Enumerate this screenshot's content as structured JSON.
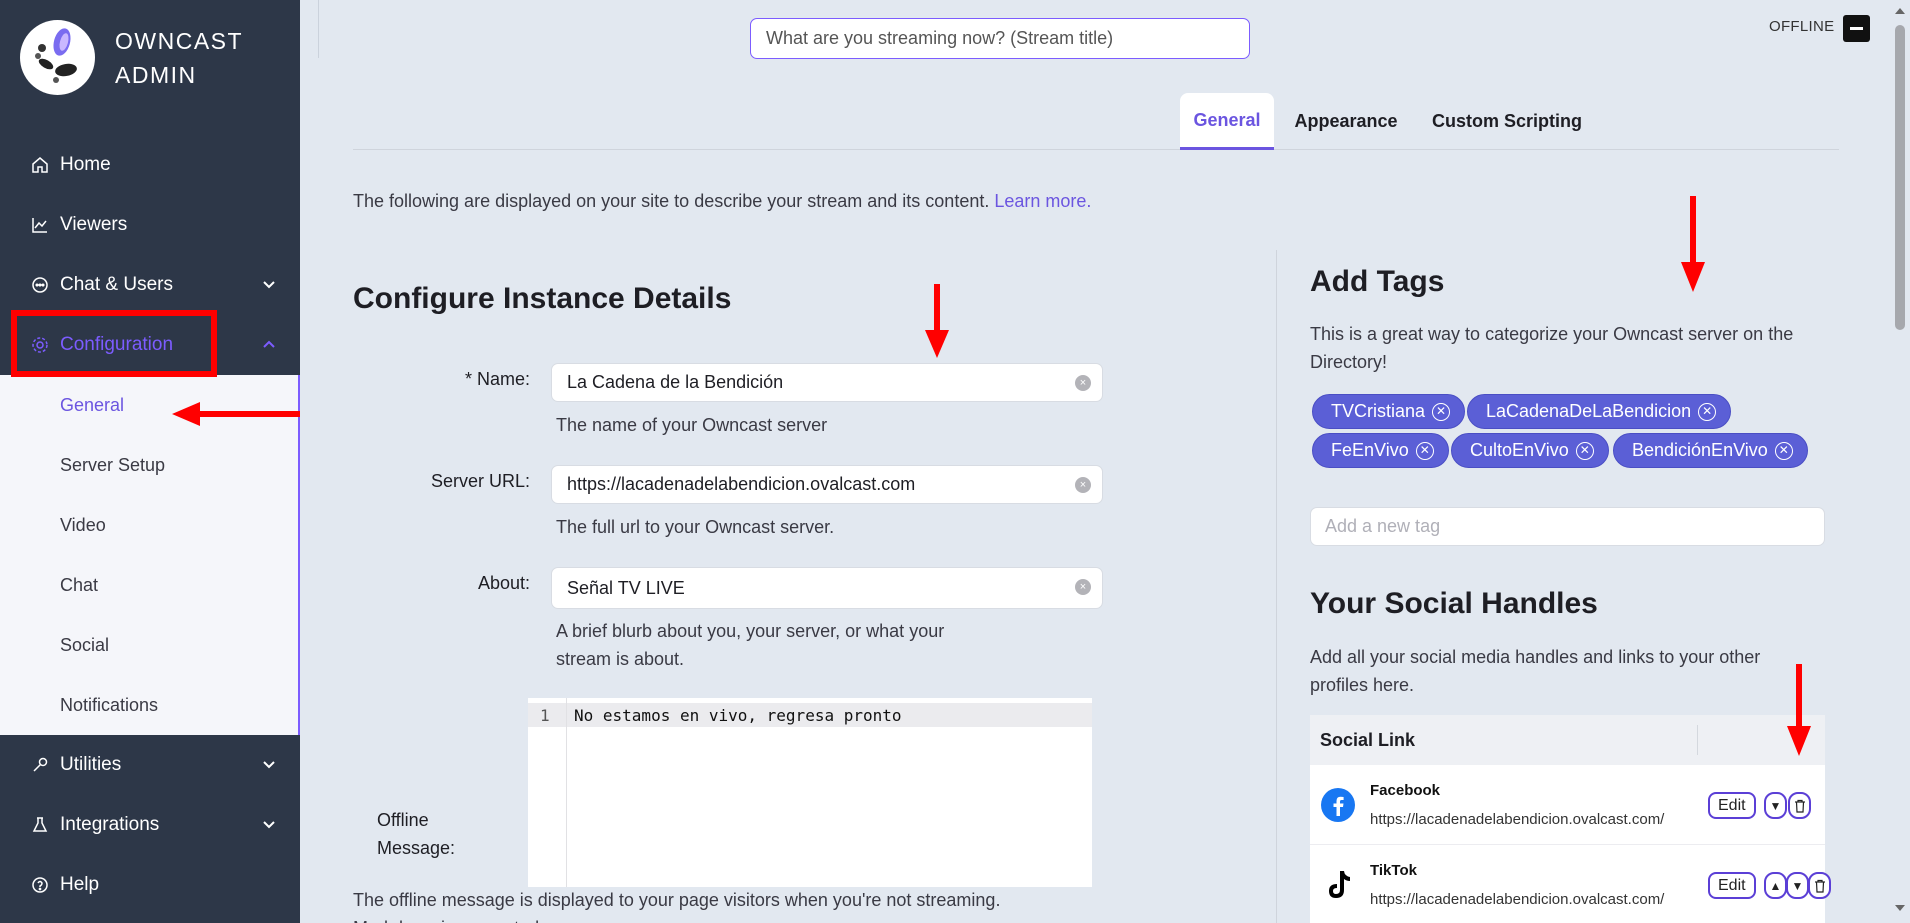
{
  "sidebar": {
    "brand_line1": "OWNCAST",
    "brand_line2": "ADMIN",
    "items": [
      {
        "label": "Home",
        "icon": "home-icon"
      },
      {
        "label": "Viewers",
        "icon": "chart-line-icon"
      },
      {
        "label": "Chat & Users",
        "icon": "chat-bubble-icon",
        "chevron": "down"
      },
      {
        "label": "Configuration",
        "icon": "gear-icon",
        "chevron": "up",
        "active": true
      },
      {
        "label": "Utilities",
        "icon": "wrench-icon",
        "chevron": "down"
      },
      {
        "label": "Integrations",
        "icon": "flask-icon",
        "chevron": "down"
      },
      {
        "label": "Help",
        "icon": "question-circle-icon"
      }
    ],
    "submenu": [
      "General",
      "Server Setup",
      "Video",
      "Chat",
      "Social",
      "Notifications"
    ]
  },
  "header": {
    "title_placeholder": "What are you streaming now? (Stream title)",
    "status": "OFFLINE"
  },
  "tabs": [
    "General",
    "Appearance",
    "Custom Scripting"
  ],
  "intro": {
    "text": "The following are displayed on your site to describe your stream and its content.",
    "link": "Learn more."
  },
  "instance": {
    "heading": "Configure Instance Details",
    "name_label": "* Name:",
    "name_value": "La Cadena de la Bendición",
    "name_help": "The name of your Owncast server",
    "url_label": "Server URL:",
    "url_value": "https://lacadenadelabendicion.ovalcast.com",
    "url_help": "The full url to your Owncast server.",
    "about_label": "About:",
    "about_value": "Señal TV LIVE",
    "about_help_1": "A brief blurb about you, your server, or what your",
    "about_help_2": "stream is about.",
    "offline_label_1": "Offline",
    "offline_label_2": "Message:",
    "offline_line_number": "1",
    "offline_message": "No estamos en vivo, regresa pronto",
    "offline_help_1": "The offline message is displayed to your page visitors when you're not streaming.",
    "offline_help_2": "Markdown is supported."
  },
  "tags": {
    "heading": "Add Tags",
    "description_1": "This is a great way to categorize your Owncast server on the",
    "description_2": "Directory!",
    "items": [
      "TVCristiana",
      "LaCadenaDeLaBendicion",
      "FeEnVivo",
      "CultoEnVivo",
      "BendiciónEnVivo"
    ],
    "input_placeholder": "Add a new tag"
  },
  "social": {
    "heading": "Your Social Handles",
    "description_1": "Add all your social media handles and links to your other",
    "description_2": "profiles here.",
    "column_header": "Social Link",
    "rows": [
      {
        "name": "Facebook",
        "url": "https://lacadenadelabendicion.ovalcast.com/",
        "edit": "Edit"
      },
      {
        "name": "TikTok",
        "url": "https://lacadenadelabendicion.ovalcast.com/",
        "edit": "Edit"
      }
    ]
  },
  "colors": {
    "sidebar_bg": "#2d3748",
    "accent": "#6b55e0",
    "tag_bg": "#5b5fd6",
    "annotation_red": "#ff0000"
  }
}
